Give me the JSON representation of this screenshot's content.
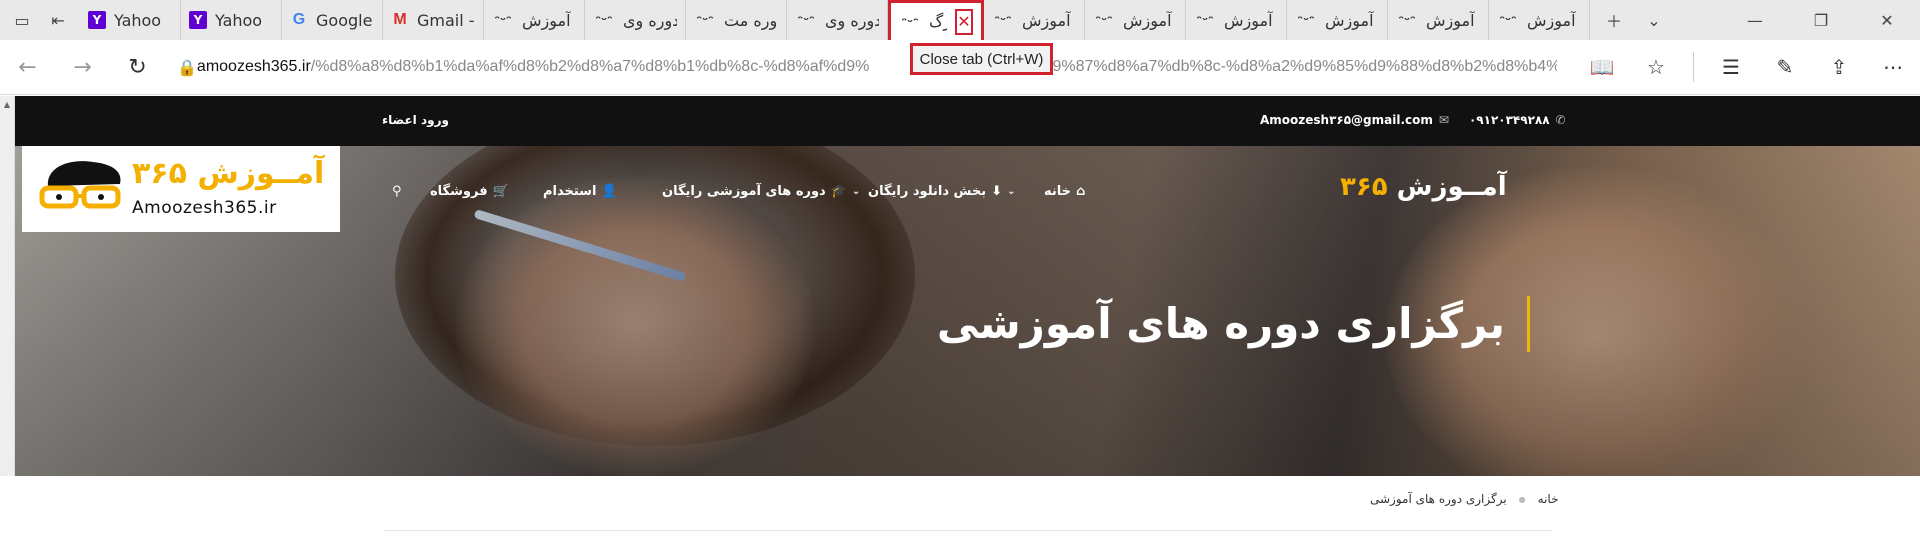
{
  "browser": {
    "tabs": [
      {
        "favicon": "site-logo-icon",
        "label": "آموزش"
      },
      {
        "favicon": "site-logo-icon",
        "label": "آموزش"
      },
      {
        "favicon": "site-logo-icon",
        "label": "آموزش"
      },
      {
        "favicon": "site-logo-icon",
        "label": "آموزش"
      },
      {
        "favicon": "site-logo-icon",
        "label": "آموزش"
      },
      {
        "favicon": "site-logo-icon",
        "label": "آموزش"
      },
      {
        "favicon": "site-logo-icon",
        "label": "برگ",
        "active": true
      },
      {
        "favicon": "site-logo-icon",
        "label": "دوره وی"
      },
      {
        "favicon": "site-logo-icon",
        "label": "دوره مت"
      },
      {
        "favicon": "site-logo-icon",
        "label": "دوره وی"
      },
      {
        "favicon": "site-logo-icon",
        "label": "آموزش"
      },
      {
        "favicon": "gmail-icon",
        "label": "Gmail -"
      },
      {
        "favicon": "google-icon",
        "label": "Google"
      },
      {
        "favicon": "yahoo-icon",
        "label": "Yahoo"
      },
      {
        "favicon": "yahoo-icon",
        "label": "Yahoo"
      }
    ],
    "close_tab_tooltip": "Close tab (Ctrl+W)",
    "url_host": "amoozesh365.ir",
    "url_path_left": "/%d8%a8%d8%b1%da%af%d8%b2%d8%a7%d8%b1%db%8c-%d8%af%d9%",
    "url_path_right": "%d9%87%d8%a7%db%8c-%d8%a2%d9%85%d9%88%d8%b2%d8%b4%"
  },
  "site": {
    "topbar": {
      "login": "ورود اعضاء",
      "phone": "۰۹۱۲۰۳۴۹۲۸۸",
      "email": "Amoozesh۳۶۵@gmail.com"
    },
    "logo_box": {
      "wordmark": "آمــوزش ۳۶۵",
      "sub": "Amoozesh365.ir"
    },
    "header_logo": {
      "word": "آمــوزش",
      "num": "۳۶۵"
    },
    "menu": {
      "home": "خانه",
      "downloads": "بخش دانلود رایگان",
      "courses": "دوره های آموزشی رایگان",
      "jobs": "استخدام",
      "shop": "فروشگاه"
    },
    "hero_title": "برگزاری دوره های آموزشی",
    "breadcrumb": {
      "home": "خانه",
      "current": "برگزاری دوره های آموزشی"
    }
  },
  "colors": {
    "accent_red": "#d0222f",
    "brand_yellow": "#f4b000",
    "topbar_bg": "#111111"
  }
}
